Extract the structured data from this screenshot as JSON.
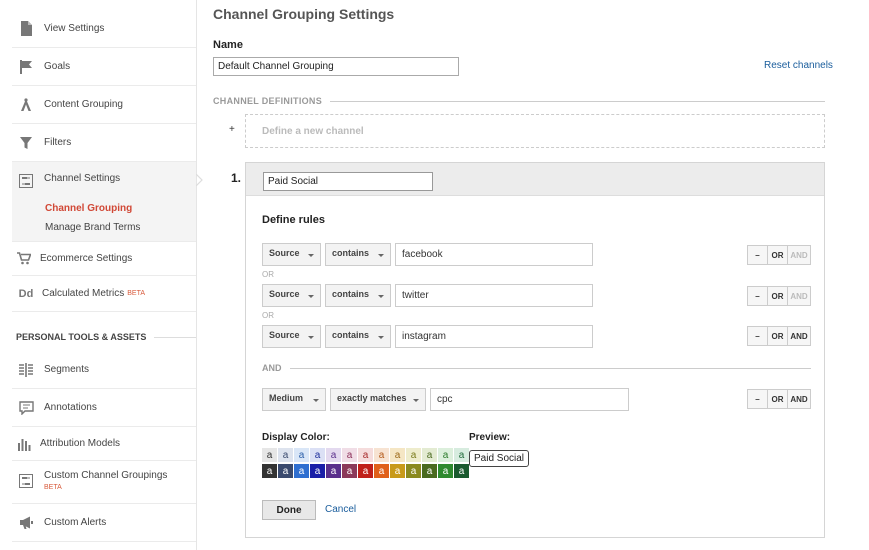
{
  "sidebar": {
    "items": [
      {
        "label": "View Settings",
        "icon": "page-icon"
      },
      {
        "label": "Goals",
        "icon": "flag-icon"
      },
      {
        "label": "Content Grouping",
        "icon": "content-grouping-icon"
      },
      {
        "label": "Filters",
        "icon": "filter-icon"
      },
      {
        "label": "Channel Settings",
        "icon": "channel-settings-icon"
      },
      {
        "label": "Ecommerce Settings",
        "icon": "cart-icon"
      },
      {
        "label": "Calculated Metrics",
        "icon": "calculated-metrics-icon",
        "badge": "BETA"
      }
    ],
    "sub_items": [
      "Channel Grouping",
      "Manage Brand Terms"
    ],
    "section_title": "PERSONAL TOOLS & ASSETS",
    "tools": [
      {
        "label": "Segments",
        "icon": "segments-icon"
      },
      {
        "label": "Annotations",
        "icon": "annotation-icon"
      },
      {
        "label": "Attribution Models",
        "icon": "bar-chart-icon"
      },
      {
        "label": "Custom Channel Groupings",
        "icon": "channel-settings-icon",
        "badge": "BETA"
      },
      {
        "label": "Custom Alerts",
        "icon": "megaphone-icon"
      }
    ]
  },
  "main": {
    "title": "Channel Grouping Settings",
    "name_label": "Name",
    "name_value": "Default Channel Grouping",
    "reset_link": "Reset channels",
    "section_title": "CHANNEL DEFINITIONS",
    "new_channel_plus": "+",
    "new_channel_label": "Define a new channel",
    "channel": {
      "number": "1.",
      "name": "Paid Social",
      "define_rules_label": "Define rules",
      "or_label": "OR",
      "and_label": "AND",
      "rules": [
        {
          "dimension": "Source",
          "operator": "contains",
          "value": "facebook",
          "buttons": [
            "–",
            "OR",
            "AND"
          ]
        },
        {
          "dimension": "Source",
          "operator": "contains",
          "value": "twitter",
          "buttons": [
            "–",
            "OR",
            "AND"
          ]
        },
        {
          "dimension": "Source",
          "operator": "contains",
          "value": "instagram",
          "buttons": [
            "–",
            "OR",
            "AND"
          ]
        },
        {
          "dimension": "Medium",
          "operator": "exactly matches",
          "value": "cpc",
          "buttons": [
            "–",
            "OR",
            "AND"
          ]
        }
      ],
      "display_color_label": "Display Color:",
      "preview_label": "Preview:",
      "preview_value": "Paid Social",
      "swatch_letter": "a",
      "swatches_light": [
        {
          "bg": "#e6e6e6",
          "fg": "#333333"
        },
        {
          "bg": "#dde3ee",
          "fg": "#3a4a6e"
        },
        {
          "bg": "#d9e6f7",
          "fg": "#2a5ea8"
        },
        {
          "bg": "#dbe0f5",
          "fg": "#1f2f9c"
        },
        {
          "bg": "#e3d9ef",
          "fg": "#5a2f8c"
        },
        {
          "bg": "#f0dde6",
          "fg": "#8c2f5a"
        },
        {
          "bg": "#f5dcdc",
          "fg": "#a82a2a"
        },
        {
          "bg": "#f7e3d2",
          "fg": "#b35a1a"
        },
        {
          "bg": "#f5e6c4",
          "fg": "#9c6a1a"
        },
        {
          "bg": "#eeeccc",
          "fg": "#7a7a1a"
        },
        {
          "bg": "#e3ebd2",
          "fg": "#4a6a1f"
        },
        {
          "bg": "#dcefdc",
          "fg": "#2a7a2a"
        },
        {
          "bg": "#d7ecdf",
          "fg": "#1f6a3a"
        }
      ],
      "swatches_dark": [
        {
          "bg": "#333333",
          "fg": "#ffffff"
        },
        {
          "bg": "#3a4a6e",
          "fg": "#ffffff"
        },
        {
          "bg": "#2f6fd0",
          "fg": "#ffffff"
        },
        {
          "bg": "#1a1fa8",
          "fg": "#ffffff"
        },
        {
          "bg": "#5a2f8c",
          "fg": "#ffffff"
        },
        {
          "bg": "#8c3a5a",
          "fg": "#ffffff"
        },
        {
          "bg": "#c0201a",
          "fg": "#ffffff"
        },
        {
          "bg": "#e0601a",
          "fg": "#ffffff"
        },
        {
          "bg": "#c89a1a",
          "fg": "#ffffff"
        },
        {
          "bg": "#8a8a1f",
          "fg": "#ffffff"
        },
        {
          "bg": "#4a6a1f",
          "fg": "#ffffff"
        },
        {
          "bg": "#2f8a2f",
          "fg": "#ffffff"
        },
        {
          "bg": "#1a5a2f",
          "fg": "#ffffff"
        }
      ],
      "done_button": "Done",
      "cancel_link": "Cancel"
    }
  },
  "colors": {
    "active_sub_item": "#d14836",
    "link": "#1a5d9c",
    "beta": "#d85b3c"
  }
}
